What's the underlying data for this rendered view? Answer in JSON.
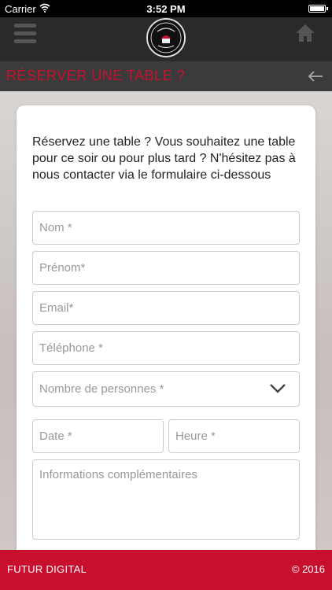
{
  "status_bar": {
    "carrier": "Carrier",
    "time": "3:52 PM"
  },
  "header": {
    "menu_icon": "hamburger-menu-icon",
    "logo": "restaurant-logo",
    "home_icon": "home-icon"
  },
  "page": {
    "title": "RÉSERVER UNE TABLE ?",
    "back_icon": "back-arrow-icon"
  },
  "form": {
    "intro": "Réservez une table ? Vous souhaitez une table pour ce soir ou pour plus tard ? N'hésitez pas à nous contacter via le formulaire ci-dessous",
    "name_placeholder": "Nom *",
    "firstname_placeholder": "Prénom*",
    "email_placeholder": "Email*",
    "phone_placeholder": "Téléphone *",
    "people_placeholder": "Nombre de personnes *",
    "date_placeholder": "Date *",
    "time_placeholder": "Heure *",
    "info_placeholder": "Informations complémentaires"
  },
  "footer": {
    "brand": "FUTUR DIGITAL",
    "copyright": "© 2016"
  },
  "colors": {
    "accent": "#c8102e",
    "header_bg": "#2a2a2a",
    "titlebar_bg": "#3b3b3b"
  }
}
